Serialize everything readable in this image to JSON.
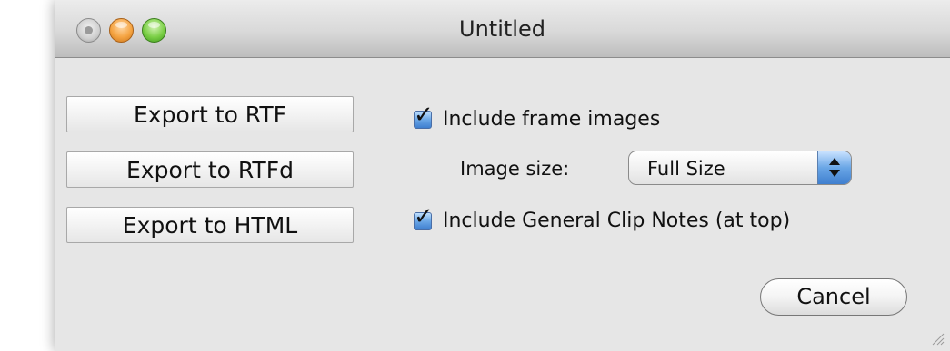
{
  "window": {
    "title": "Untitled"
  },
  "export_buttons": [
    {
      "label": "Export to RTF"
    },
    {
      "label": "Export to RTFd"
    },
    {
      "label": "Export to HTML"
    }
  ],
  "options": {
    "include_frame_images": {
      "label": "Include frame images",
      "checked": true
    },
    "image_size": {
      "label": "Image size:",
      "value": "Full Size"
    },
    "include_general_clip_notes": {
      "label": "Include General Clip Notes (at top)",
      "checked": true
    }
  },
  "actions": {
    "cancel_label": "Cancel"
  },
  "icons": {
    "close": "close-icon",
    "minimize": "minimize-icon",
    "zoom": "zoom-icon",
    "checkmark": "checkmark-icon",
    "popup_arrows": "up-down-arrows-icon",
    "resize": "resize-grip-icon"
  },
  "colors": {
    "window_background": "#e6e6e6",
    "close_button": "#cfcfcf",
    "minimize_button": "#f5a442",
    "zoom_button": "#7bcf46",
    "accent": "#6aa6e6"
  }
}
